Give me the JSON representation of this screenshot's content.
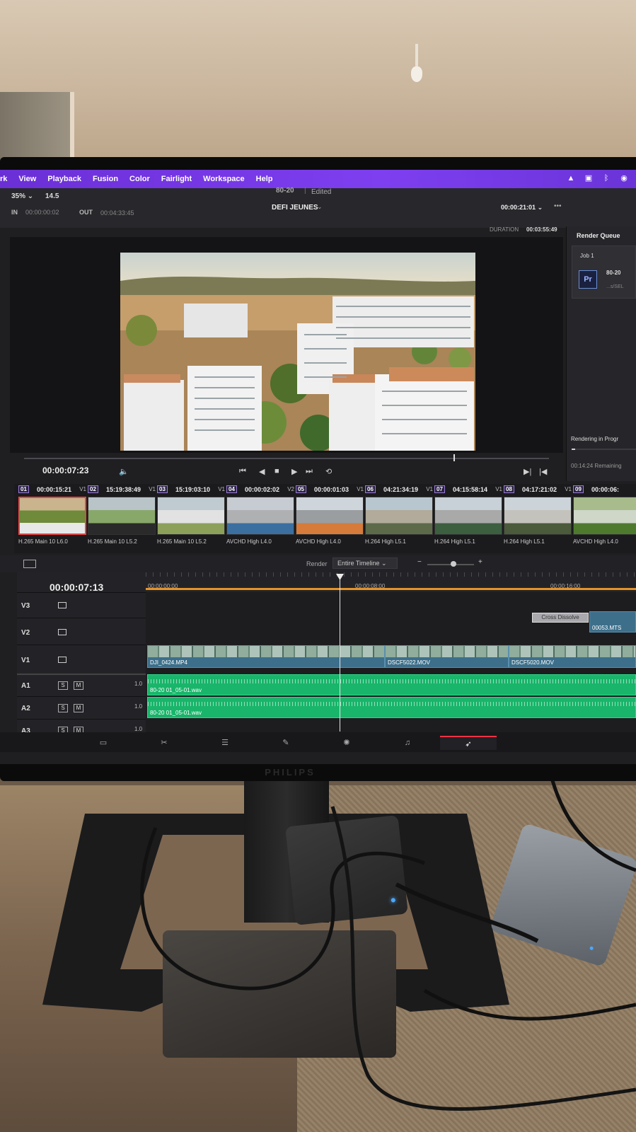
{
  "menu": [
    "rk",
    "View",
    "Playback",
    "Fusion",
    "Color",
    "Fairlight",
    "Workspace",
    "Help"
  ],
  "brand": "PHILIPS",
  "viewer": {
    "zoom": "35%",
    "zoom_chevron": "⌄",
    "fps": "14.5",
    "project_name": "80-20",
    "project_separator": "|",
    "project_status": "Edited",
    "in_label": "IN",
    "in_tc": "00:00:00:02",
    "out_label": "OUT",
    "out_tc": "00:04:33:45",
    "timeline_name": "DEFI JEUNES",
    "timeline_chevron": "⌄",
    "tc_right": "00:00:21:01",
    "tc_right_chevron": "⌄",
    "more": "•••",
    "duration_label": "DURATION",
    "duration_value": "00:03:55:49",
    "current_tc": "00:00:07:23"
  },
  "render_queue": {
    "title": "Render Queue",
    "job_label": "Job 1",
    "app_icon": "Pr",
    "job_name": "80-20",
    "job_path": "...s/SEL",
    "progress_label": "Rendering in Progr",
    "progress": 0.05,
    "remaining": "00:14:24 Remaining"
  },
  "transport": {
    "volume_icon": "🔈",
    "first": "⏮",
    "prev": "◀",
    "stop": "■",
    "play": "▶",
    "last": "⏭",
    "loop": "⟲",
    "mark_in": "▶|",
    "mark_out": "|◀"
  },
  "thumbnails": [
    {
      "num": "01",
      "tc": "00:00:15:21",
      "track": "V1",
      "codec": "H.265 Main 10 L6.0"
    },
    {
      "num": "02",
      "tc": "15:19:38:49",
      "track": "V1",
      "codec": "H.265 Main 10 L5.2"
    },
    {
      "num": "03",
      "tc": "15:19:03:10",
      "track": "V1",
      "codec": "H.265 Main 10 L5.2"
    },
    {
      "num": "04",
      "tc": "00:00:02:02",
      "track": "V2",
      "codec": "AVCHD High L4.0"
    },
    {
      "num": "05",
      "tc": "00:00:01:03",
      "track": "V1",
      "codec": "AVCHD High L4.0"
    },
    {
      "num": "06",
      "tc": "04:21:34:19",
      "track": "V1",
      "codec": "H.264 High L5.1"
    },
    {
      "num": "07",
      "tc": "04:15:58:14",
      "track": "V1",
      "codec": "H.264 High L5.1"
    },
    {
      "num": "08",
      "tc": "04:17:21:02",
      "track": "V1",
      "codec": "H.264 High L5.1"
    },
    {
      "num": "09",
      "tc": "00:00:06:",
      "track": "",
      "codec": "AVCHD High L4.0"
    }
  ],
  "timeline": {
    "render_label": "Render",
    "render_value": "Entire Timeline",
    "render_chevron": "⌄",
    "zoom_minus": "−",
    "zoom_plus": "+",
    "current_tc": "00:00:07:13",
    "ruler": [
      "00:00:00:00",
      "00:00:08:00",
      "00:00:16:00"
    ],
    "tracks": [
      {
        "name": "V3",
        "type": "video"
      },
      {
        "name": "V2",
        "type": "video"
      },
      {
        "name": "V1",
        "type": "video"
      },
      {
        "name": "A1",
        "type": "audio",
        "s": "S",
        "m": "M",
        "vol": "1.0"
      },
      {
        "name": "A2",
        "type": "audio",
        "s": "S",
        "m": "M",
        "vol": "1.0"
      },
      {
        "name": "A3",
        "type": "audio",
        "s": "S",
        "m": "M",
        "vol": "1.0"
      }
    ],
    "clips": {
      "v1_a": "DJI_0424.MP4",
      "v1_b": "DSCF5022.MOV",
      "v1_c": "DSCF5020.MOV",
      "v2_a": "00053.MTS",
      "transition": "Cross Dissolve",
      "a1": "80-20 01_05-01.wav",
      "a2": "80-20 01_05-01.wav"
    }
  },
  "pages": [
    "media-icon",
    "cut-icon",
    "edit-icon",
    "fusion-icon",
    "color-icon",
    "fairlight-icon",
    "deliver-icon"
  ],
  "active_page": 6,
  "colors": {
    "menubar": "#7e3ff0",
    "audio_clip": "#19b56a",
    "video_clip": "#3d6f8a",
    "ruler_range": "#e5932a",
    "active_page": "#e33344"
  }
}
